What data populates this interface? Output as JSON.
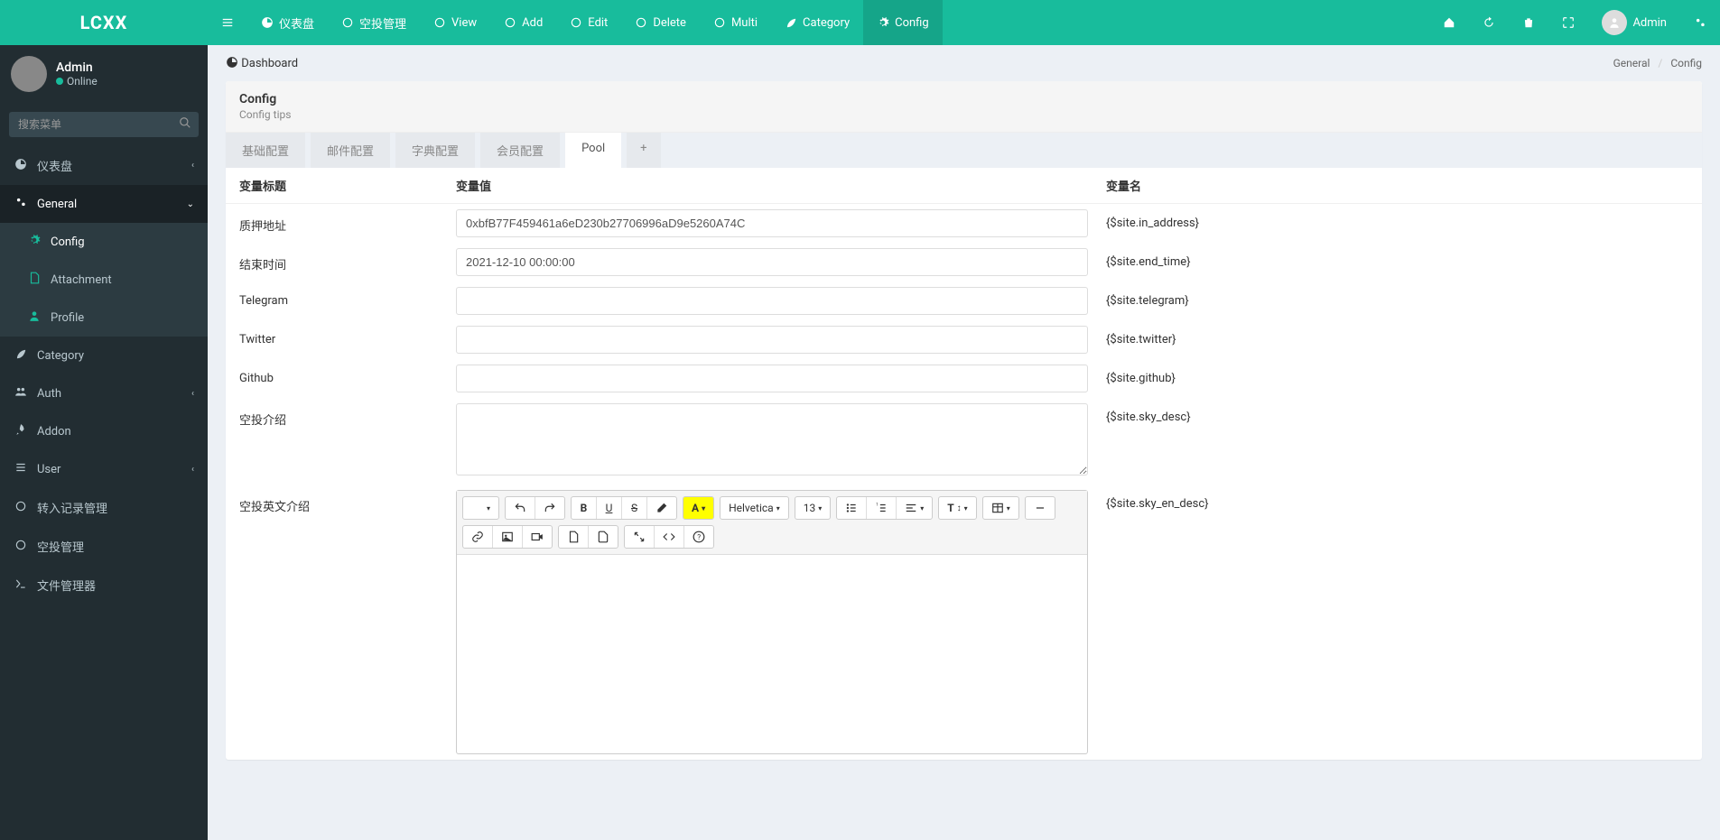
{
  "brand": "LCXX",
  "topnav": {
    "left": [
      {
        "id": "dashboard",
        "label": "仪表盘",
        "icon": "dashboard"
      },
      {
        "id": "airdrop",
        "label": "空投管理",
        "icon": "circle"
      },
      {
        "id": "view",
        "label": "View",
        "icon": "circle"
      },
      {
        "id": "add",
        "label": "Add",
        "icon": "circle"
      },
      {
        "id": "edit",
        "label": "Edit",
        "icon": "circle"
      },
      {
        "id": "delete",
        "label": "Delete",
        "icon": "circle"
      },
      {
        "id": "multi",
        "label": "Multi",
        "icon": "circle"
      },
      {
        "id": "category",
        "label": "Category",
        "icon": "leaf"
      },
      {
        "id": "config",
        "label": "Config",
        "icon": "cog",
        "active": true
      }
    ],
    "right_user": "Admin"
  },
  "sidebar": {
    "user": {
      "name": "Admin",
      "status": "Online"
    },
    "search_placeholder": "搜索菜单",
    "items": [
      {
        "label": "仪表盘",
        "icon": "dashboard",
        "chev": true
      },
      {
        "label": "General",
        "icon": "cogs",
        "chev": true,
        "open": true,
        "sub": [
          {
            "label": "Config",
            "icon": "cog",
            "sel": true
          },
          {
            "label": "Attachment",
            "icon": "file"
          },
          {
            "label": "Profile",
            "icon": "user"
          }
        ]
      },
      {
        "label": "Category",
        "icon": "leaf"
      },
      {
        "label": "Auth",
        "icon": "group",
        "chev": true
      },
      {
        "label": "Addon",
        "icon": "rocket"
      },
      {
        "label": "User",
        "icon": "list",
        "chev": true
      },
      {
        "label": "转入记录管理",
        "icon": "circle"
      },
      {
        "label": "空投管理",
        "icon": "circle"
      },
      {
        "label": "文件管理器",
        "icon": "terminal"
      }
    ]
  },
  "breadcrumb": {
    "dash": "Dashboard",
    "crumbs": [
      "General",
      "Config"
    ]
  },
  "panel": {
    "title": "Config",
    "subtitle": "Config tips"
  },
  "tabs": [
    "基础配置",
    "邮件配置",
    "字典配置",
    "会员配置",
    "Pool"
  ],
  "active_tab": "Pool",
  "table_header": {
    "col1": "变量标题",
    "col2": "变量值",
    "col3": "变量名"
  },
  "rows": [
    {
      "title": "质押地址",
      "value": "0xbfB77F459461a6eD230b27706996aD9e5260A74C",
      "var": "{$site.in_address}",
      "type": "text"
    },
    {
      "title": "结束时间",
      "value": "2021-12-10 00:00:00",
      "var": "{$site.end_time}",
      "type": "text"
    },
    {
      "title": "Telegram",
      "value": "",
      "var": "{$site.telegram}",
      "type": "text"
    },
    {
      "title": "Twitter",
      "value": "",
      "var": "{$site.twitter}",
      "type": "text"
    },
    {
      "title": "Github",
      "value": "",
      "var": "{$site.github}",
      "type": "text"
    },
    {
      "title": "空投介绍",
      "value": "",
      "var": "{$site.sky_desc}",
      "type": "textarea"
    },
    {
      "title": "空投英文介绍",
      "value": "",
      "var": "{$site.sky_en_desc}",
      "type": "editor"
    }
  ],
  "editor": {
    "font": "Helvetica",
    "size": "13"
  }
}
